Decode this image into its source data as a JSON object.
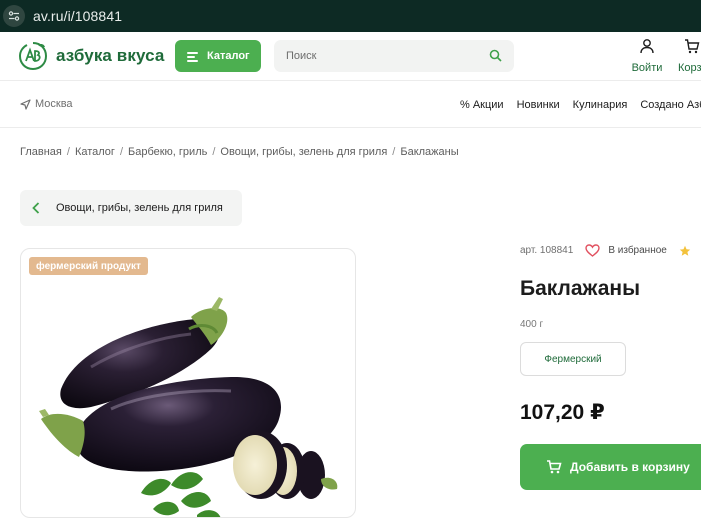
{
  "browser": {
    "url": "av.ru/i/108841"
  },
  "header": {
    "logo_text": "азбука вкуса",
    "catalog_label": "Каталог",
    "search_placeholder": "Поиск",
    "login_label": "Войти",
    "cart_label": "Корзина"
  },
  "subnav": {
    "city": "Москва",
    "links": [
      "% Акции",
      "Новинки",
      "Кулинария",
      "Создано Азбукой"
    ]
  },
  "breadcrumb": [
    "Главная",
    "Каталог",
    "Барбекю, гриль",
    "Овощи, грибы, зелень для гриля",
    "Баклажаны"
  ],
  "back_chip": {
    "label": "Овощи, грибы, зелень для гриля"
  },
  "product": {
    "badge": "фермерский продукт",
    "article": "арт. 108841",
    "favorite_label": "В избранное",
    "title": "Баклажаны",
    "weight": "400 г",
    "tag": "Фермерский",
    "price": "107,20 ₽",
    "add_to_cart_label": "Добавить в корзину"
  },
  "colors": {
    "brand_green": "#4caf50",
    "dark_green": "#1f6b3a",
    "badge": "#e3b98f",
    "url_bar": "#0d2a24"
  }
}
